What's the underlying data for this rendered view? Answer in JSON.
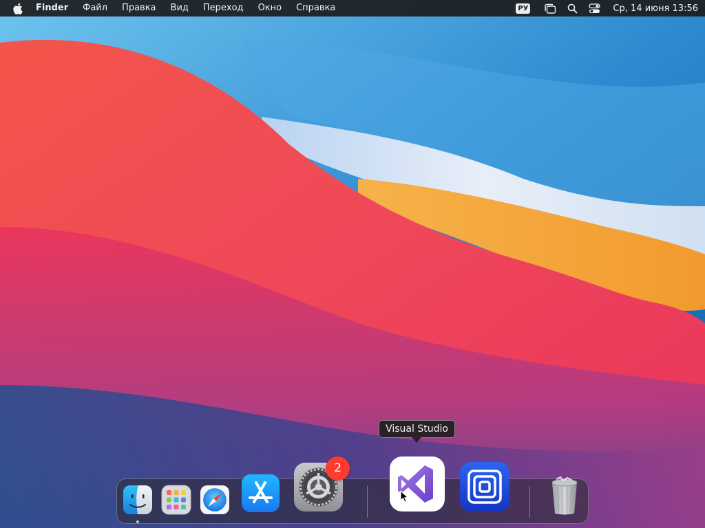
{
  "menubar": {
    "app_name": "Finder",
    "items": [
      "Файл",
      "Правка",
      "Вид",
      "Переход",
      "Окно",
      "Справка"
    ],
    "input_source": "РУ",
    "clock": "Ср, 14 июня  13:56"
  },
  "dock": {
    "apps": [
      {
        "name": "Finder",
        "icon": "finder-icon",
        "running": true
      },
      {
        "name": "Launchpad",
        "icon": "launchpad-icon",
        "running": false
      },
      {
        "name": "Safari",
        "icon": "safari-icon",
        "running": false
      },
      {
        "name": "App Store",
        "icon": "app-store-icon",
        "running": false
      },
      {
        "name": "System Preferences",
        "icon": "system-preferences-icon",
        "running": false,
        "badge": "2"
      },
      {
        "name": "Visual Studio",
        "icon": "visual-studio-icon",
        "running": false,
        "hovered": true
      },
      {
        "name": "Screen Recorder",
        "icon": "screen-recorder-icon",
        "running": false
      },
      {
        "name": "Trash",
        "icon": "trash-icon",
        "running": false
      }
    ],
    "tooltip": "Visual Studio"
  },
  "colors": {
    "menubar_bg": "#1c1c1e",
    "badge_red": "#ff3b30",
    "visual_studio_purple": "#8a5cd6",
    "app_store_blue": "#1a8cff",
    "screen_recorder_blue": "#1d47d8"
  }
}
